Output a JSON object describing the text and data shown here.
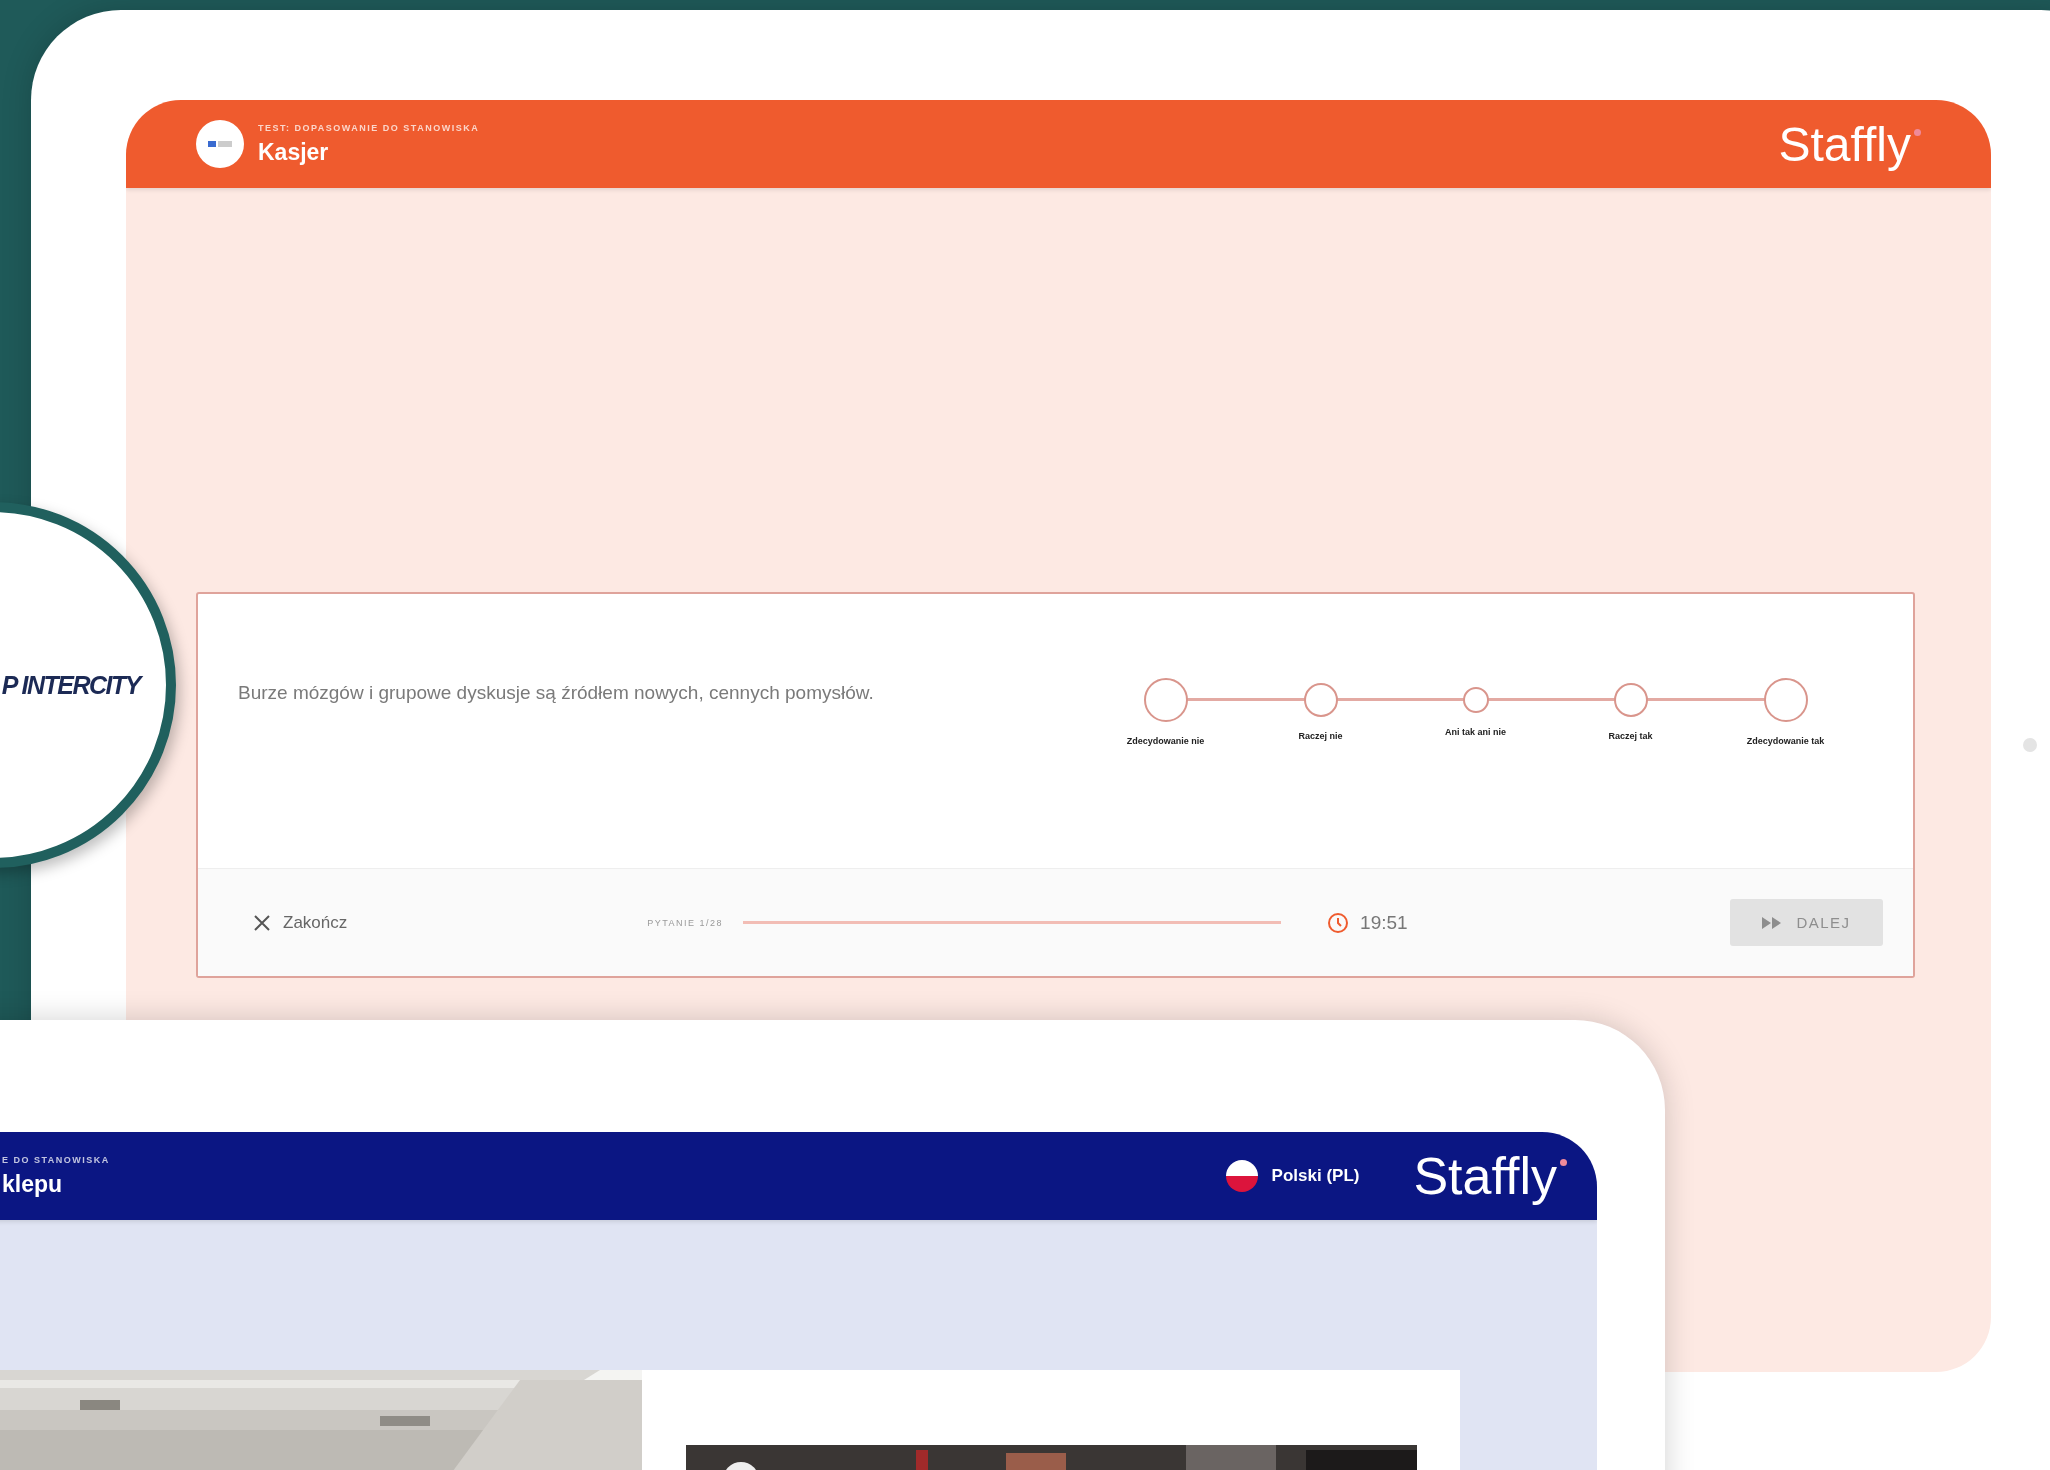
{
  "top_screen": {
    "header": {
      "subtitle": "TEST: DOPASOWANIE DO STANOWISKA",
      "title": "Kasjer",
      "brand": "Staffly"
    },
    "question": {
      "text": "Burze mózgów i grupowe dyskusje są źródłem nowych, cennych pomysłów.",
      "options": [
        {
          "label": "Zdecydowanie nie",
          "selected": false
        },
        {
          "label": "Raczej nie",
          "selected": false
        },
        {
          "label": "Ani tak ani nie",
          "selected": false
        },
        {
          "label": "Raczej tak",
          "selected": false
        },
        {
          "label": "Zdecydowanie tak",
          "selected": false
        }
      ]
    },
    "footer": {
      "close_label": "Zakończ",
      "progress_label": "PYTANIE 1/28",
      "timer": "19:51",
      "next_button": {
        "label": "DALEJ",
        "disabled": true
      }
    }
  },
  "client_logo": {
    "text": "P INTERCITY"
  },
  "bottom_screen": {
    "header": {
      "subtitle": "E DO STANOWISKA",
      "title": "klepu",
      "language": "Polski (PL)",
      "brand": "Staffly"
    }
  }
}
